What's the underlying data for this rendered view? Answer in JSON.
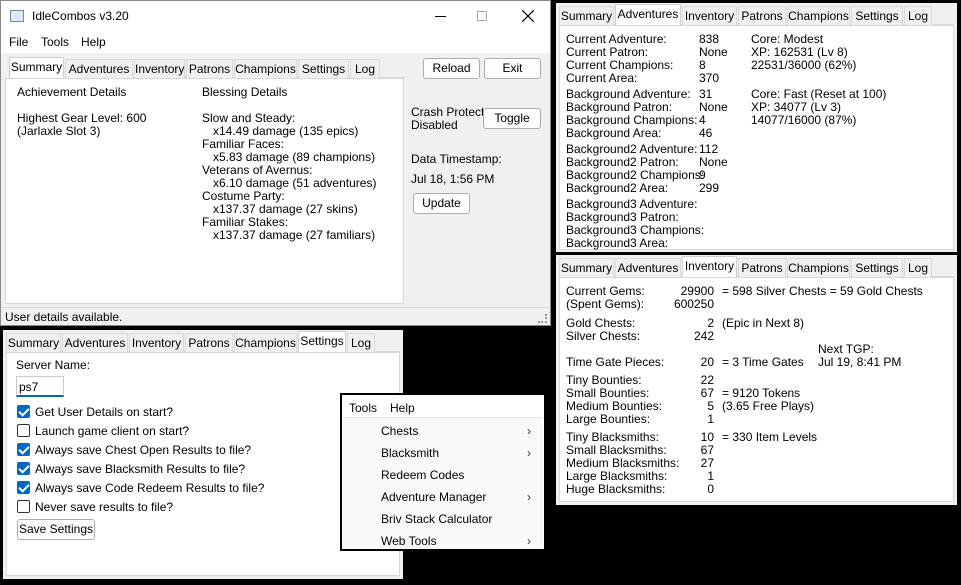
{
  "main_window": {
    "title": "IdleCombos v3.20",
    "menubar": [
      "File",
      "Tools",
      "Help"
    ],
    "tabs": [
      "Summary",
      "Adventures",
      "Inventory",
      "Patrons",
      "Champions",
      "Settings",
      "Log"
    ],
    "reload_label": "Reload",
    "exit_label": "Exit",
    "achievement_header": "Achievement Details",
    "gear_line1": "Highest Gear Level: 600",
    "gear_line2": "(Jarlaxle Slot 3)",
    "blessing_header": "Blessing Details",
    "blessings": [
      {
        "name": "Slow and Steady:",
        "value": "x14.49 damage (135 epics)"
      },
      {
        "name": "Familiar Faces:",
        "value": "x5.83 damage (89 champions)"
      },
      {
        "name": "Veterans of Avernus:",
        "value": "x6.10 damage (51 adventures)"
      },
      {
        "name": "Costume Party:",
        "value": "x137.37 damage (27 skins)"
      },
      {
        "name": "Familiar Stakes:",
        "value": "x137.37 damage (27 familiars)"
      }
    ],
    "crash_protect_line1": "Crash Protect",
    "crash_protect_line2": "Disabled",
    "toggle_label": "Toggle",
    "data_timestamp_label": "Data Timestamp:",
    "data_timestamp_value": "Jul 18, 1:56 PM",
    "update_label": "Update",
    "status_text": "User details available."
  },
  "adventures_panel": {
    "tabs": [
      "Summary",
      "Adventures",
      "Inventory",
      "Patrons",
      "Champions",
      "Settings",
      "Log"
    ],
    "rows": [
      {
        "label": "Current Adventure:",
        "value": "838"
      },
      {
        "label": "Current Patron:",
        "value": "None"
      },
      {
        "label": "Current Champions:",
        "value": "8"
      },
      {
        "label": "Current Area:",
        "value": "370"
      },
      {
        "label": "Background Adventure:",
        "value": "31"
      },
      {
        "label": "Background Patron:",
        "value": "None"
      },
      {
        "label": "Background Champions:",
        "value": "4"
      },
      {
        "label": "Background Area:",
        "value": "46"
      },
      {
        "label": "Background2 Adventure:",
        "value": "112"
      },
      {
        "label": "Background2 Patron:",
        "value": "None"
      },
      {
        "label": "Background2 Champions:",
        "value": "9"
      },
      {
        "label": "Background2 Area:",
        "value": "299"
      },
      {
        "label": "Background3 Adventure:",
        "value": ""
      },
      {
        "label": "Background3 Patron:",
        "value": ""
      },
      {
        "label": "Background3 Champions:",
        "value": ""
      },
      {
        "label": "Background3 Area:",
        "value": ""
      }
    ],
    "core1": {
      "line1": "Core: Modest",
      "line2": "XP: 162531 (Lv 8)",
      "line3": "22531/36000 (62%)"
    },
    "core2": {
      "line1": "Core: Fast (Reset at 100)",
      "line2": "XP: 34077 (Lv 3)",
      "line3": "14077/16000 (87%)"
    }
  },
  "inventory_panel": {
    "tabs": [
      "Summary",
      "Adventures",
      "Inventory",
      "Patrons",
      "Champions",
      "Settings",
      "Log"
    ],
    "rows": [
      {
        "label": "Current Gems:",
        "value": "29900",
        "note": "= 598 Silver Chests = 59 Gold Chests"
      },
      {
        "label": "(Spent Gems):",
        "value": "600250",
        "note": ""
      },
      {
        "label": "Gold Chests:",
        "value": "2",
        "note": "(Epic in Next 8)"
      },
      {
        "label": "Silver Chests:",
        "value": "242",
        "note": ""
      },
      {
        "label": "Time Gate Pieces:",
        "value": "20",
        "note": "= 3 Time Gates"
      },
      {
        "label": "Tiny Bounties:",
        "value": "22",
        "note": ""
      },
      {
        "label": "Small Bounties:",
        "value": "67",
        "note": "= 9120 Tokens"
      },
      {
        "label": "Medium Bounties:",
        "value": "5",
        "note": "(3.65 Free Plays)"
      },
      {
        "label": "Large Bounties:",
        "value": "1",
        "note": ""
      },
      {
        "label": "Tiny Blacksmiths:",
        "value": "10",
        "note": "= 330 Item Levels"
      },
      {
        "label": "Small Blacksmiths:",
        "value": "67",
        "note": ""
      },
      {
        "label": "Medium Blacksmiths:",
        "value": "27",
        "note": ""
      },
      {
        "label": "Large Blacksmiths:",
        "value": "1",
        "note": ""
      },
      {
        "label": "Huge Blacksmiths:",
        "value": "0",
        "note": ""
      }
    ],
    "next_tgp_label": "Next TGP:",
    "next_tgp_value": "Jul 19, 8:41 PM"
  },
  "settings_panel": {
    "tabs": [
      "Summary",
      "Adventures",
      "Inventory",
      "Patrons",
      "Champions",
      "Settings",
      "Log"
    ],
    "server_name_label": "Server Name:",
    "server_name_value": "ps7",
    "options": [
      {
        "label": "Get User Details on start?",
        "checked": true
      },
      {
        "label": "Launch game client on start?",
        "checked": false
      },
      {
        "label": "Always save Chest Open Results to file?",
        "checked": true
      },
      {
        "label": "Always save Blacksmith Results to file?",
        "checked": true
      },
      {
        "label": "Always save Code Redeem Results to file?",
        "checked": true
      },
      {
        "label": "Never save results to file?",
        "checked": false
      }
    ],
    "save_label": "Save Settings"
  },
  "tools_menu": {
    "menubar": [
      "Tools",
      "Help"
    ],
    "items": [
      {
        "label": "Chests",
        "submenu": true
      },
      {
        "label": "Blacksmith",
        "submenu": true
      },
      {
        "label": "Redeem Codes",
        "submenu": false
      },
      {
        "label": "Adventure Manager",
        "submenu": true
      },
      {
        "label": "Briv Stack Calculator",
        "submenu": false
      },
      {
        "label": "Web Tools",
        "submenu": true
      }
    ]
  },
  "colors": {
    "accent": "#0067c0",
    "background": "#000000",
    "panel": "#f0f0f0"
  }
}
